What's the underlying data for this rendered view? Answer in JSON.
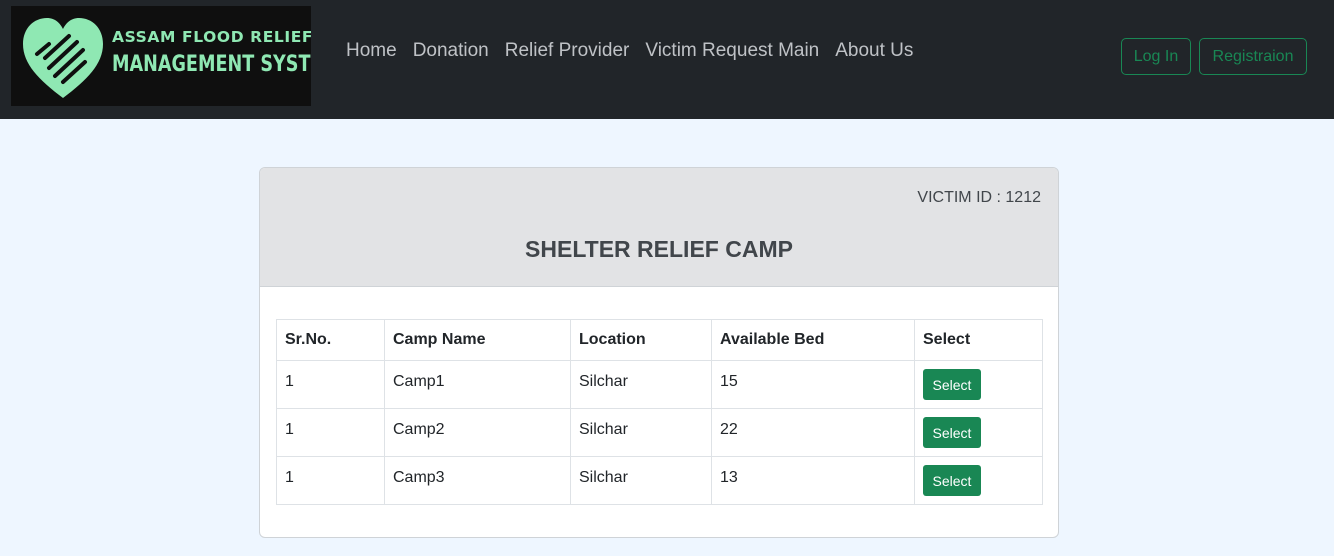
{
  "brand": {
    "line1": "ASSAM FLOOD RELIEF",
    "line2": "MANAGEMENT SYSTEM",
    "logo_icon": "heart-hands-icon",
    "color": "#8fe8b3"
  },
  "nav": {
    "items": [
      "Home",
      "Donation",
      "Relief Provider",
      "Victim Request Main",
      "About Us"
    ]
  },
  "auth": {
    "login_label": "Log In",
    "register_label": "Registraion"
  },
  "card": {
    "victim_id_text": "VICTIM ID : 1212",
    "title": "SHELTER RELIEF CAMP"
  },
  "table": {
    "headers": [
      "Sr.No.",
      "Camp Name",
      "Location",
      "Available Bed",
      "Select"
    ],
    "rows": [
      {
        "sr": "1",
        "camp": "Camp1",
        "location": "Silchar",
        "beds": "15",
        "action": "Select"
      },
      {
        "sr": "1",
        "camp": "Camp2",
        "location": "Silchar",
        "beds": "22",
        "action": "Select"
      },
      {
        "sr": "1",
        "camp": "Camp3",
        "location": "Silchar",
        "beds": "13",
        "action": "Select"
      }
    ]
  },
  "colors": {
    "navbar": "#212529",
    "page_background": "#eef6ff",
    "accent_green": "#198754",
    "card_header": "#e2e3e5"
  }
}
